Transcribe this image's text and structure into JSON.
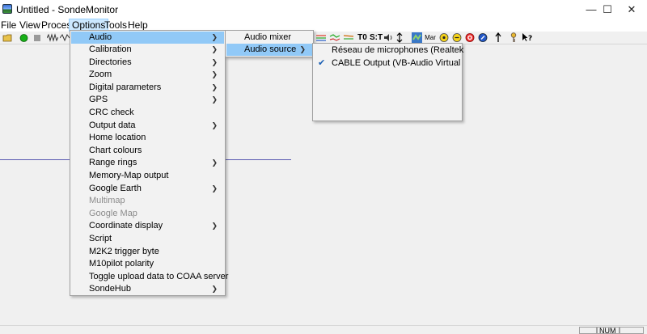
{
  "window": {
    "title": "Untitled - SondeMonitor",
    "minimize": "—",
    "maximize": "☐",
    "close": "✕"
  },
  "menubar": [
    "File",
    "View",
    "Process",
    "Options",
    "Tools",
    "Help"
  ],
  "toolbar": {
    "t1": "T0",
    "t2": "S:T",
    "t3": "Mar"
  },
  "options_menu": [
    {
      "label": "Audio",
      "submenu": true,
      "highlighted": true
    },
    {
      "label": "Calibration",
      "submenu": true
    },
    {
      "label": "Directories",
      "submenu": true
    },
    {
      "label": "Zoom",
      "submenu": true
    },
    {
      "label": "Digital parameters",
      "submenu": true
    },
    {
      "label": "GPS",
      "submenu": true
    },
    {
      "label": "CRC check",
      "submenu": false
    },
    {
      "label": "Output data",
      "submenu": true
    },
    {
      "label": "Home location",
      "submenu": false
    },
    {
      "label": "Chart colours",
      "submenu": false
    },
    {
      "label": "Range rings",
      "submenu": true
    },
    {
      "label": "Memory-Map output",
      "submenu": false
    },
    {
      "label": "Google Earth",
      "submenu": true
    },
    {
      "label": "Multimap",
      "submenu": false,
      "disabled": true
    },
    {
      "label": "Google Map",
      "submenu": false,
      "disabled": true
    },
    {
      "label": "Coordinate display",
      "submenu": true
    },
    {
      "label": "Script",
      "submenu": false
    },
    {
      "label": "M2K2 trigger byte",
      "submenu": false
    },
    {
      "label": "M10pilot polarity",
      "submenu": false
    },
    {
      "label": "Toggle upload data to COAA server",
      "submenu": false
    },
    {
      "label": "SondeHub",
      "submenu": true
    }
  ],
  "audio_menu": [
    {
      "label": "Audio mixer",
      "submenu": false
    },
    {
      "label": "Audio source",
      "submenu": true,
      "highlighted": true
    }
  ],
  "audio_source_menu": [
    {
      "label": "Réseau de microphones (Realtek",
      "checked": false
    },
    {
      "label": "CABLE Output (VB-Audio Virtual",
      "checked": true
    }
  ],
  "status": {
    "num": "NUM"
  }
}
